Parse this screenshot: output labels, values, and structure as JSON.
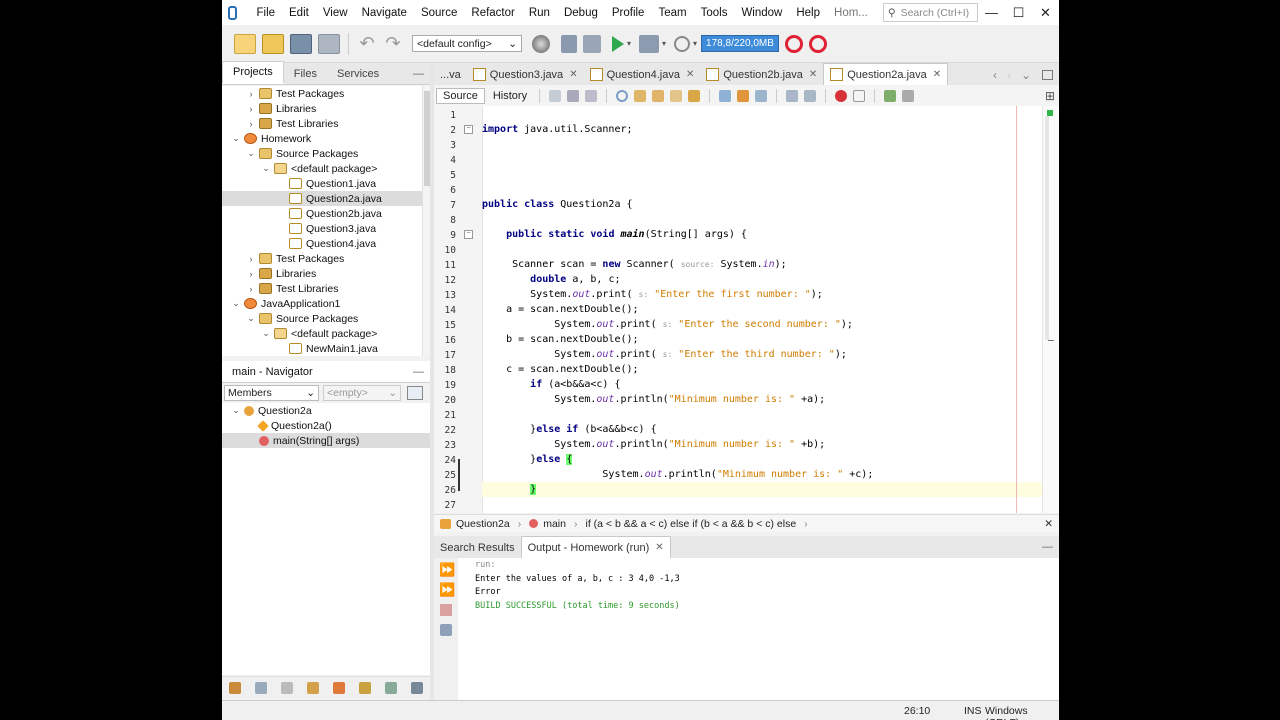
{
  "menu": {
    "items": [
      "File",
      "Edit",
      "View",
      "Navigate",
      "Source",
      "Refactor",
      "Run",
      "Debug",
      "Profile",
      "Team",
      "Tools",
      "Window",
      "Help",
      "Hom..."
    ],
    "search_placeholder": "Search (Ctrl+I)",
    "window_controls": [
      "—",
      "☐",
      "✕"
    ]
  },
  "toolbar": {
    "config": "<default config>",
    "memory": "178,8/220,0MB"
  },
  "projects_panel": {
    "tabs": [
      "Projects",
      "Files",
      "Services"
    ],
    "tree": [
      {
        "label": "Test Packages",
        "indent": 1,
        "toggle": "›",
        "icon": "folder"
      },
      {
        "label": "Libraries",
        "indent": 1,
        "toggle": "›",
        "icon": "lib"
      },
      {
        "label": "Test Libraries",
        "indent": 1,
        "toggle": "›",
        "icon": "lib"
      },
      {
        "label": "Homework",
        "indent": 0,
        "toggle": "⌄",
        "icon": "proj"
      },
      {
        "label": "Source Packages",
        "indent": 1,
        "toggle": "⌄",
        "icon": "folder"
      },
      {
        "label": "<default package>",
        "indent": 2,
        "toggle": "⌄",
        "icon": "pkg"
      },
      {
        "label": "Question1.java",
        "indent": 3,
        "toggle": "",
        "icon": "java"
      },
      {
        "label": "Question2a.java",
        "indent": 3,
        "toggle": "",
        "icon": "java",
        "selected": true
      },
      {
        "label": "Question2b.java",
        "indent": 3,
        "toggle": "",
        "icon": "java"
      },
      {
        "label": "Question3.java",
        "indent": 3,
        "toggle": "",
        "icon": "java"
      },
      {
        "label": "Question4.java",
        "indent": 3,
        "toggle": "",
        "icon": "java"
      },
      {
        "label": "Test Packages",
        "indent": 1,
        "toggle": "›",
        "icon": "folder"
      },
      {
        "label": "Libraries",
        "indent": 1,
        "toggle": "›",
        "icon": "lib"
      },
      {
        "label": "Test Libraries",
        "indent": 1,
        "toggle": "›",
        "icon": "lib"
      },
      {
        "label": "JavaApplication1",
        "indent": 0,
        "toggle": "⌄",
        "icon": "proj"
      },
      {
        "label": "Source Packages",
        "indent": 1,
        "toggle": "⌄",
        "icon": "folder"
      },
      {
        "label": "<default package>",
        "indent": 2,
        "toggle": "⌄",
        "icon": "pkg"
      },
      {
        "label": "NewMain1.java",
        "indent": 3,
        "toggle": "",
        "icon": "java"
      }
    ]
  },
  "navigator": {
    "title": "main - Navigator",
    "filter": "Members",
    "filter2": "<empty>",
    "tree": [
      {
        "label": "Question2a",
        "indent": 0,
        "toggle": "⌄",
        "icon": "cls"
      },
      {
        "label": "Question2a()",
        "indent": 1,
        "toggle": "",
        "icon": "ctor"
      },
      {
        "label": "main(String[] args)",
        "indent": 1,
        "toggle": "",
        "icon": "meth",
        "selected": true
      }
    ]
  },
  "editor": {
    "tabs": [
      {
        "label": "...va",
        "active": false,
        "close": false
      },
      {
        "label": "Question3.java",
        "active": false,
        "close": true
      },
      {
        "label": "Question4.java",
        "active": false,
        "close": true
      },
      {
        "label": "Question2b.java",
        "active": false,
        "close": true
      },
      {
        "label": "Question2a.java",
        "active": true,
        "close": true
      }
    ],
    "source_btn": "Source",
    "history_btn": "History",
    "line_numbers": [
      "1",
      "2",
      "3",
      "4",
      "5",
      "6",
      "7",
      "8",
      "9",
      "10",
      "11",
      "12",
      "13",
      "14",
      "15",
      "16",
      "17",
      "18",
      "19",
      "20",
      "21",
      "22",
      "23",
      "24",
      "25",
      "26",
      "27"
    ]
  },
  "breadcrumb": {
    "class": "Question2a",
    "method": "main",
    "context": "if (a < b && a < c) else if (b < a && b < c) else"
  },
  "output": {
    "tabs": [
      {
        "label": "Search Results",
        "active": false
      },
      {
        "label": "Output - Homework (run)",
        "active": true
      }
    ],
    "lines": [
      {
        "text": "run:",
        "color": "#888888"
      },
      {
        "text": "Enter the values of a, b, c : 3 4,0 -1,3",
        "color": "#000000"
      },
      {
        "text": "Error",
        "color": "#000000"
      },
      {
        "text": "BUILD SUCCESSFUL (total time: 9 seconds)",
        "color": "#2e9a2e"
      }
    ]
  },
  "status": {
    "position": "26:10",
    "mode": "INS",
    "line_ending": "Windows (CRLF)"
  }
}
